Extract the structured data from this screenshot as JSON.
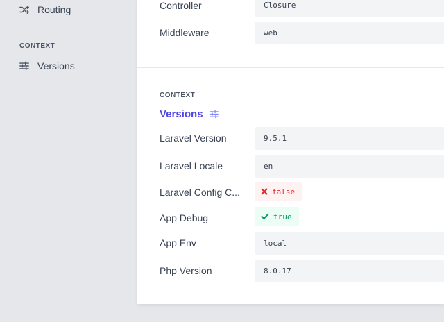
{
  "sidebar": {
    "routing_label": "Routing",
    "context_heading": "CONTEXT",
    "versions_label": "Versions"
  },
  "routing_rows": [
    {
      "label": "Controller",
      "value": "Closure"
    },
    {
      "label": "Middleware",
      "value": "web"
    }
  ],
  "context": {
    "heading": "CONTEXT",
    "title": "Versions",
    "rows": [
      {
        "label": "Laravel Version",
        "value": "9.5.1"
      },
      {
        "label": "Laravel Locale",
        "value": "en"
      },
      {
        "label": "Laravel Config C...",
        "value": "false"
      },
      {
        "label": "App Debug",
        "value": "true"
      },
      {
        "label": "App Env",
        "value": "local"
      },
      {
        "label": "Php Version",
        "value": "8.0.17"
      }
    ]
  },
  "colors": {
    "accent": "#4f46e5",
    "false_badge": "#dc2626",
    "true_badge": "#059669"
  },
  "icons": {
    "routing": "shuffle-icon",
    "versions": "sliders-icon",
    "false": "x-icon",
    "true": "check-icon"
  }
}
